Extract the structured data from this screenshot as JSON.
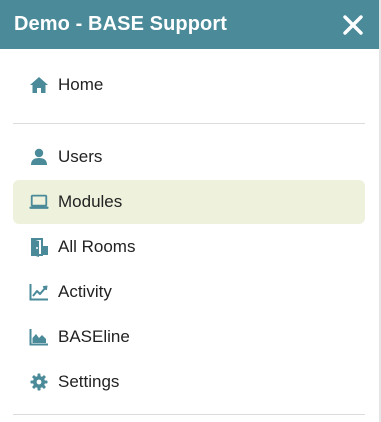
{
  "header": {
    "title": "Demo - BASE Support"
  },
  "menu": {
    "home": "Home",
    "users": "Users",
    "modules": "Modules",
    "all_rooms": "All Rooms",
    "activity": "Activity",
    "baseline": "BASEline",
    "settings": "Settings"
  },
  "colors": {
    "header_bg": "#4a8a99",
    "icon": "#4a8a99",
    "active_bg": "#eef2dc"
  },
  "icons": {
    "home": "home-icon",
    "users": "user-icon",
    "modules": "laptop-icon",
    "all_rooms": "door-icon",
    "activity": "line-chart-icon",
    "baseline": "area-chart-icon",
    "settings": "gear-icon",
    "close": "close-icon"
  },
  "state": {
    "active_item": "modules"
  }
}
